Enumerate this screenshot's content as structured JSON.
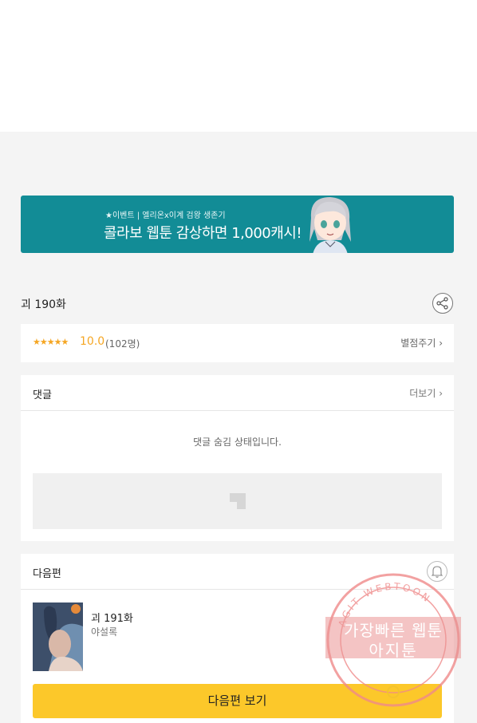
{
  "banner": {
    "small_text": "★이벤트 | 엘리온x이계 검왕 생존기",
    "big_text": "콜라보 웹툰 감상하면 1,000캐시!"
  },
  "episode": {
    "title": "괴 190화"
  },
  "rating": {
    "stars": "★★★★★",
    "score": "10.0",
    "count": "(102명)",
    "rate_label": "별점주기 ›"
  },
  "comments": {
    "title": "댓글",
    "more_label": "더보기 ›",
    "hidden_message": "댓글 숨김 상태입니다."
  },
  "next": {
    "section_title": "다음편",
    "episode_title": "괴 191화",
    "author": "야설록",
    "button_label": "다음편 보기"
  },
  "watermark": {
    "ring_text": "AGIT WEBTOON",
    "line1": "가장빠른 웹툰",
    "line2": "아지툰"
  },
  "colors": {
    "banner_bg": "#128c96",
    "accent_star": "#f5a623",
    "next_button": "#fcc82a"
  }
}
